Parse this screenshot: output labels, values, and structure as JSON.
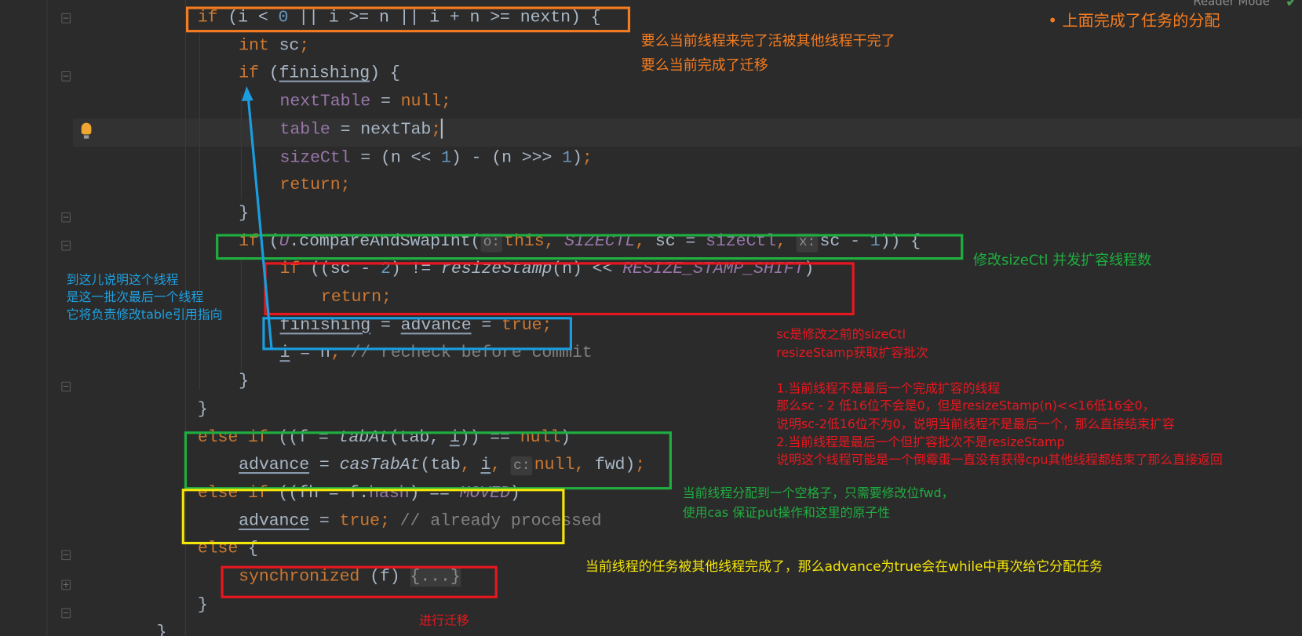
{
  "toolbar": {
    "reader_mode_label": "Reader Mode",
    "status_icon": "check-icon",
    "status_color": "#499c54"
  },
  "colors": {
    "background": "#2b2b2b",
    "keyword": "#cc7832",
    "field": "#9876aa",
    "number": "#6897bb",
    "text": "#a9b7c6",
    "comment": "#808080"
  },
  "code_lines": [
    {
      "indent": 0,
      "tokens": [
        [
          "if",
          "k"
        ],
        [
          " (i < ",
          ""
        ],
        [
          "0",
          "n"
        ],
        [
          " || i >= n || i + n >= nextn) {",
          ""
        ]
      ]
    },
    {
      "indent": 1,
      "tokens": [
        [
          "int",
          "k"
        ],
        [
          " sc",
          ""
        ],
        [
          ";",
          "k"
        ]
      ]
    },
    {
      "indent": 1,
      "tokens": [
        [
          "if",
          "k"
        ],
        [
          " (",
          ""
        ],
        [
          "finishing",
          "u"
        ],
        [
          ") {",
          ""
        ]
      ]
    },
    {
      "indent": 2,
      "tokens": [
        [
          "nextTable",
          "f"
        ],
        [
          " = ",
          ""
        ],
        [
          "null",
          "k"
        ],
        [
          ";",
          "k"
        ]
      ]
    },
    {
      "indent": 2,
      "tokens": [
        [
          "table",
          "f"
        ],
        [
          " = nextTab",
          ""
        ],
        [
          ";",
          "k"
        ],
        [
          "",
          "caret"
        ]
      ]
    },
    {
      "indent": 2,
      "tokens": [
        [
          "sizeCtl",
          "f"
        ],
        [
          " = (n << ",
          ""
        ],
        [
          "1",
          "n"
        ],
        [
          ") - (n >>> ",
          ""
        ],
        [
          "1",
          "n"
        ],
        [
          ")",
          ""
        ],
        [
          ";",
          "k"
        ]
      ]
    },
    {
      "indent": 2,
      "tokens": [
        [
          "return",
          "k"
        ],
        [
          ";",
          "k"
        ]
      ]
    },
    {
      "indent": 1,
      "tokens": [
        [
          "}",
          ""
        ]
      ]
    },
    {
      "indent": 1,
      "tokens": [
        [
          "if",
          "k"
        ],
        [
          " (",
          ""
        ],
        [
          "U",
          "fi"
        ],
        [
          ".compareAndSwapInt(",
          ""
        ],
        [
          "o:",
          "h"
        ],
        [
          "this",
          "k"
        ],
        [
          ", ",
          "k"
        ],
        [
          "SIZECTL",
          "fi"
        ],
        [
          ", ",
          "k"
        ],
        [
          "sc = ",
          ""
        ],
        [
          "sizeCtl",
          "f"
        ],
        [
          ", ",
          "k"
        ],
        [
          "x:",
          "h"
        ],
        [
          "sc - ",
          ""
        ],
        [
          "1",
          "n"
        ],
        [
          ")) {",
          ""
        ]
      ]
    },
    {
      "indent": 2,
      "tokens": [
        [
          "if",
          "k"
        ],
        [
          " ((sc - ",
          ""
        ],
        [
          "2",
          "n"
        ],
        [
          ") != ",
          ""
        ],
        [
          "resizeStamp",
          "m"
        ],
        [
          "(n) << ",
          ""
        ],
        [
          "RESIZE_STAMP_SHIFT",
          "fi"
        ],
        [
          ")",
          ""
        ]
      ]
    },
    {
      "indent": 3,
      "tokens": [
        [
          "return",
          "k"
        ],
        [
          ";",
          "k"
        ]
      ]
    },
    {
      "indent": 2,
      "tokens": [
        [
          "finishing",
          "u"
        ],
        [
          " = ",
          ""
        ],
        [
          "advance",
          "u"
        ],
        [
          " = ",
          ""
        ],
        [
          "true",
          "k"
        ],
        [
          ";",
          "k"
        ]
      ]
    },
    {
      "indent": 2,
      "tokens": [
        [
          "i",
          "u"
        ],
        [
          " = n",
          ""
        ],
        [
          "; ",
          "k"
        ],
        [
          "// recheck before commit",
          "c"
        ]
      ]
    },
    {
      "indent": 1,
      "tokens": [
        [
          "}",
          ""
        ]
      ]
    },
    {
      "indent": 0,
      "tokens": [
        [
          "}",
          ""
        ]
      ]
    },
    {
      "indent": 0,
      "tokens": [
        [
          "else if",
          "k"
        ],
        [
          " ((f = ",
          ""
        ],
        [
          "tabAt",
          "m"
        ],
        [
          "(tab, ",
          ""
        ],
        [
          "i",
          "u"
        ],
        [
          ")) == ",
          ""
        ],
        [
          "null",
          "k"
        ],
        [
          ")",
          ""
        ]
      ]
    },
    {
      "indent": 1,
      "tokens": [
        [
          "advance",
          "u"
        ],
        [
          " = ",
          ""
        ],
        [
          "casTabAt",
          "m"
        ],
        [
          "(tab",
          ""
        ],
        [
          ", ",
          "k"
        ],
        [
          "i",
          "u"
        ],
        [
          ", ",
          "k"
        ],
        [
          "c:",
          "h"
        ],
        [
          "null",
          "k"
        ],
        [
          ", ",
          "k"
        ],
        [
          "fwd)",
          ""
        ],
        [
          ";",
          "k"
        ]
      ]
    },
    {
      "indent": 0,
      "tokens": [
        [
          "else if",
          "k"
        ],
        [
          " ((fh = f.",
          ""
        ],
        [
          "hash",
          "f"
        ],
        [
          ") == ",
          ""
        ],
        [
          "MOVED",
          "fi"
        ],
        [
          ")",
          ""
        ]
      ]
    },
    {
      "indent": 1,
      "tokens": [
        [
          "advance",
          "u"
        ],
        [
          " = ",
          ""
        ],
        [
          "true",
          "k"
        ],
        [
          "; ",
          "k"
        ],
        [
          "// already processed",
          "c"
        ]
      ]
    },
    {
      "indent": 0,
      "tokens": [
        [
          "else",
          "k"
        ],
        [
          " {",
          ""
        ]
      ]
    },
    {
      "indent": 1,
      "tokens": [
        [
          "synchronized",
          "k"
        ],
        [
          " (f) ",
          ""
        ],
        [
          "{...}",
          "fb"
        ]
      ]
    },
    {
      "indent": 0,
      "tokens": [
        [
          "}",
          ""
        ]
      ]
    },
    {
      "indent": -1,
      "tokens": [
        [
          "}",
          ""
        ]
      ]
    }
  ],
  "annotations": {
    "top_right": "• 上面完成了任务的分配",
    "orange": [
      "要么当前线程来完了活被其他线程干完了",
      "要么当前完成了迁移"
    ],
    "green_cas": "修改sizeCtl 并发扩容线程数",
    "blue": [
      "到这儿说明这个线程",
      "是这一批次最后一个线程",
      "它将负责修改table引用指向"
    ],
    "red": [
      "sc是修改之前的sizeCtl",
      "resizeStamp获取扩容批次",
      "",
      "1.当前线程不是最后一个完成扩容的线程",
      "那么sc - 2 低16位不会是0，但是resizeStamp(n)<<16低16全0，",
      "说明sc-2低16位不为0，说明当前线程不是最后一个，那么直接结束扩容",
      "2.当前线程是最后一个但扩容批次不是resizeStamp",
      "说明这个线程可能是一个倒霉蛋一直没有获得cpu其他线程都结束了那么直接返回"
    ],
    "green_empty": [
      "当前线程分配到一个空格子，只需要修改位fwd，",
      "使用cas 保证put操作和这里的原子性"
    ],
    "yellow": "当前线程的任务被其他线程完成了，那么advance为true会在while中再次给它分配任务",
    "migrate": "进行迁移"
  }
}
